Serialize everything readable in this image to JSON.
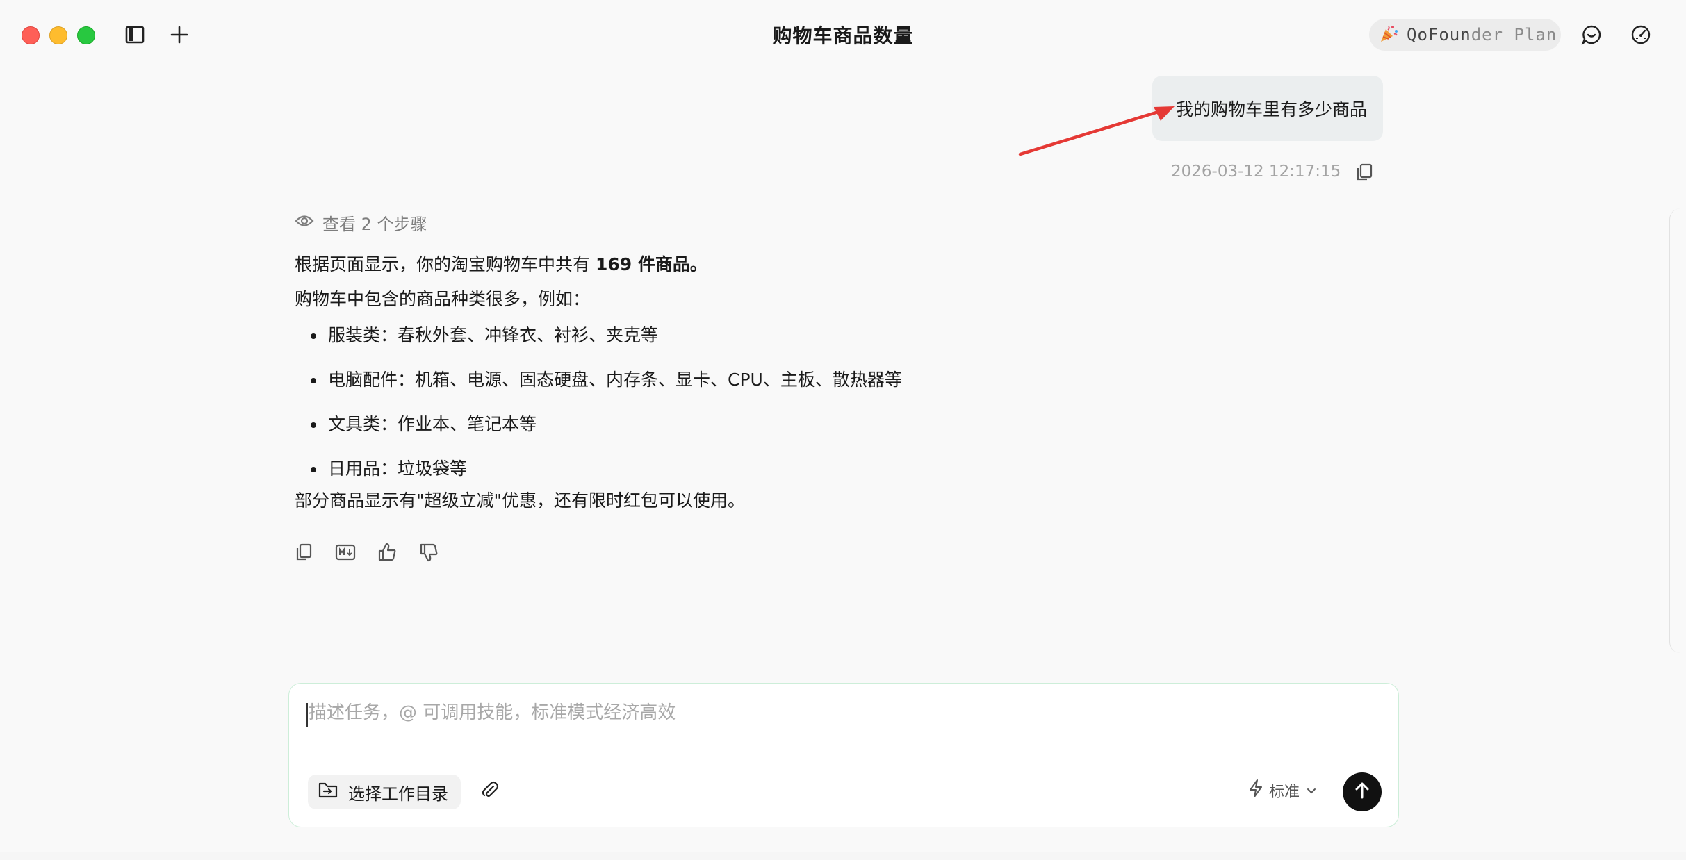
{
  "window": {
    "title": "购物车商品数量",
    "plan_badge": {
      "prefix": "Qo",
      "mid": "Foun",
      "suffix": "der Plan"
    }
  },
  "user_message": {
    "text": "我的购物车里有多少商品",
    "timestamp": "2026-03-12 12:17:15"
  },
  "assistant": {
    "steps_label": "查看 2 个步骤",
    "line1_prefix": "根据页面显示，你的淘宝购物车中共有 ",
    "line1_bold": "169 件商品。",
    "line2": "购物车中包含的商品种类很多，例如：",
    "items": [
      "服装类：春秋外套、冲锋衣、衬衫、夹克等",
      "电脑配件：机箱、电源、固态硬盘、内存条、显卡、CPU、主板、散热器等",
      "文具类：作业本、笔记本等",
      "日用品：垃圾袋等"
    ],
    "line3": "部分商品显示有\"超级立减\"优惠，还有限时红包可以使用。"
  },
  "composer": {
    "placeholder": "描述任务，@ 可调用技能，标准模式经济高效",
    "dir_button": "选择工作目录",
    "mode_label": "标准"
  },
  "colors": {
    "accent_border": "#cdeed9",
    "send_button": "#111111",
    "annotation_arrow": "#e53935"
  }
}
